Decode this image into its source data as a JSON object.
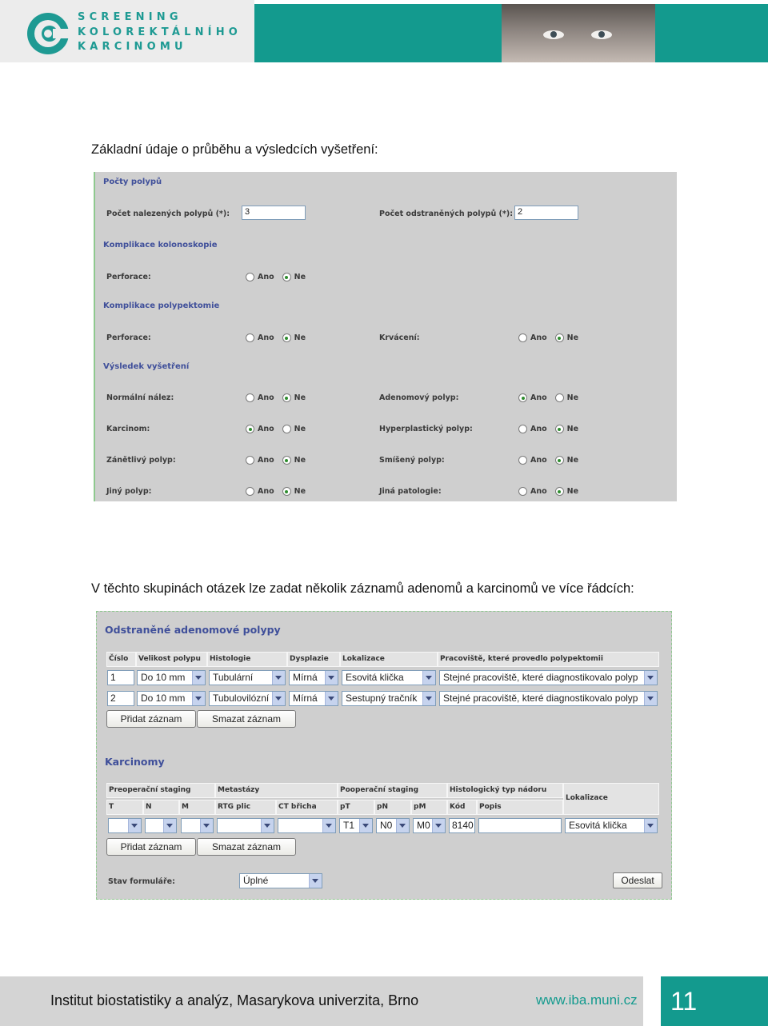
{
  "header": {
    "logo_lines": [
      "SCREENING",
      "KOLOREKTÁLNÍHO",
      "KARCINOMU"
    ],
    "colors": {
      "teal": "#139a8e",
      "logo_text": "#1e9a93",
      "logo_bg": "#ececec"
    },
    "logo_icon": "swirl-c-logo-icon",
    "photo_icon": "face-photo-icon"
  },
  "caption1": "Základní údaje o průběhu a výsledcích vyšetření:",
  "caption2": "V těchto skupinách otázek lze zadat několik záznamů adenomů a karcinomů ve více řádcích:",
  "form1": {
    "sec_counts": "Počty polypů",
    "found_label": "Počet nalezených polypů (*):",
    "found_value": "3",
    "removed_label": "Počet odstraněných polypů (*):",
    "removed_value": "2",
    "sec_colono": "Komplikace kolonoskopie",
    "perforation_label": "Perforace:",
    "sec_polyp": "Komplikace polypektomie",
    "perforation2_label": "Perforace:",
    "bleeding_label": "Krvácení:",
    "sec_result": "Výsledek vyšetření",
    "normal_label": "Normální nález:",
    "adenoma_label": "Adenomový polyp:",
    "carcinoma_label": "Karcinom:",
    "hyperplastic_label": "Hyperplastický polyp:",
    "inflammatory_label": "Zánětlivý polyp:",
    "mixed_label": "Smíšený polyp:",
    "other_polyp_label": "Jiný polyp:",
    "other_path_label": "Jiná patologie:",
    "yes": "Ano",
    "no": "Ne"
  },
  "form2": {
    "sec_adenoma": "Odstraněné adenomové polypy",
    "cols": [
      "Číslo",
      "Velikost polypu",
      "Histologie",
      "Dysplazie",
      "Lokalizace",
      "Pracoviště, které provedlo polypektomii"
    ],
    "rows": [
      [
        "1",
        "Do 10 mm",
        "Tubulární",
        "Mírná",
        "Esovitá klička",
        "Stejné pracoviště, které diagnostikovalo polyp"
      ],
      [
        "2",
        "Do 10 mm",
        "Tubulovilózní",
        "Mírná",
        "Sestupný tračník",
        "Stejné pracoviště, které diagnostikovalo polyp"
      ]
    ],
    "add_label": "Přidat záznam",
    "delete_label": "Smazat záznam",
    "sec_carcinoma": "Karcinomy",
    "groups": [
      "Preoperační staging",
      "Metastázy",
      "Pooperační staging",
      "Histologický typ nádoru",
      "Lokalizace"
    ],
    "subcols": [
      "T",
      "N",
      "M",
      "RTG plic",
      "CT břicha",
      "pT",
      "pN",
      "pM",
      "Kód",
      "Popis"
    ],
    "carc_values": {
      "pT": "T1",
      "pN": "N0",
      "pM": "M0",
      "code": "8140",
      "loc": "Esovitá klička"
    },
    "status_label": "Stav formuláře:",
    "status_value": "Úplné",
    "submit_label": "Odeslat"
  },
  "footer": {
    "institute": "Institut biostatistiky a analýz, Masarykova univerzita, Brno",
    "url": "www.iba.muni.cz",
    "page": "11"
  }
}
